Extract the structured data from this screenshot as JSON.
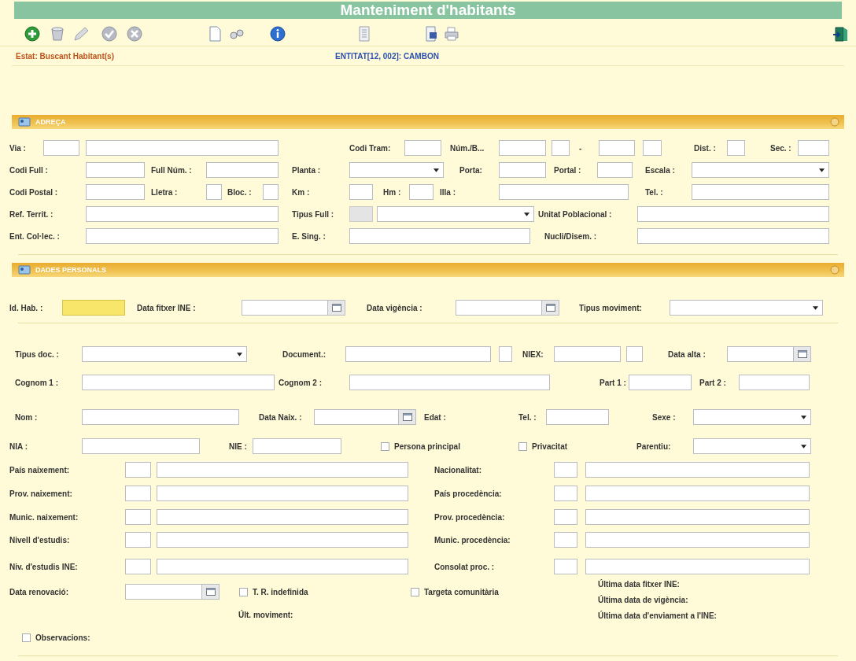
{
  "title": "Manteniment d'habitants",
  "toolbar": [
    {
      "kind": "add"
    },
    {
      "kind": "delete"
    },
    {
      "kind": "edit"
    },
    {
      "kind": "accept"
    },
    {
      "kind": "cancel"
    },
    {
      "kind": "new"
    },
    {
      "kind": "view"
    },
    {
      "kind": "info"
    },
    {
      "kind": "list"
    },
    {
      "kind": "export"
    },
    {
      "kind": "print"
    },
    {
      "kind": "exit"
    }
  ],
  "status": "Estat: Buscant Habitant(s)",
  "entity": "ENTITAT[12, 002]: CAMBON",
  "sections": [
    {
      "title": "ADREÇA",
      "rows": [
        {
          "fields": [
            {
              "kind": "label",
              "text": "Via :"
            },
            {
              "kind": "input"
            },
            {
              "kind": "input"
            },
            {
              "kind": "label",
              "text": "Codi Tram:"
            },
            {
              "kind": "input"
            },
            {
              "kind": "label",
              "text": "Núm./B..."
            },
            {
              "kind": "input"
            },
            {
              "kind": "input"
            },
            {
              "kind": "label",
              "text": "-"
            },
            {
              "kind": "input"
            },
            {
              "kind": "input"
            },
            {
              "kind": "label",
              "text": "Dist. :"
            },
            {
              "kind": "input"
            },
            {
              "kind": "label",
              "text": "Sec. :"
            },
            {
              "kind": "input"
            }
          ]
        },
        {
          "fields": [
            {
              "kind": "label",
              "text": "Codi Full :"
            },
            {
              "kind": "input"
            },
            {
              "kind": "label",
              "text": "Full Núm. :"
            },
            {
              "kind": "input"
            },
            {
              "kind": "label",
              "text": "Planta :"
            },
            {
              "kind": "select"
            },
            {
              "kind": "label",
              "text": "Porta:"
            },
            {
              "kind": "input"
            },
            {
              "kind": "label",
              "text": "Portal :"
            },
            {
              "kind": "input"
            },
            {
              "kind": "label",
              "text": "Escala :"
            },
            {
              "kind": "select"
            }
          ]
        },
        {
          "fields": [
            {
              "kind": "label",
              "text": "Codi Postal :"
            },
            {
              "kind": "input"
            },
            {
              "kind": "label",
              "text": "Lletra :"
            },
            {
              "kind": "input"
            },
            {
              "kind": "label",
              "text": "Bloc. :"
            },
            {
              "kind": "input"
            },
            {
              "kind": "label",
              "text": "Km :"
            },
            {
              "kind": "input"
            },
            {
              "kind": "label",
              "text": "Hm :"
            },
            {
              "kind": "input"
            },
            {
              "kind": "label",
              "text": "Illa :"
            },
            {
              "kind": "input"
            },
            {
              "kind": "label",
              "text": "Tel. :"
            },
            {
              "kind": "input"
            }
          ]
        },
        {
          "fields": [
            {
              "kind": "label",
              "text": "Ref. Territ. :"
            },
            {
              "kind": "input"
            },
            {
              "kind": "label",
              "text": "Tipus Full :"
            },
            {
              "kind": "input",
              "disabled": true
            },
            {
              "kind": "select"
            },
            {
              "kind": "label",
              "text": "Unitat Poblacional :"
            },
            {
              "kind": "input"
            }
          ]
        },
        {
          "fields": [
            {
              "kind": "label",
              "text": "Ent. Col·lec. :"
            },
            {
              "kind": "input"
            },
            {
              "kind": "label",
              "text": "E. Sing. :"
            },
            {
              "kind": "input"
            },
            {
              "kind": "label",
              "text": "Nucli/Disem. :"
            },
            {
              "kind": "input"
            }
          ]
        }
      ]
    },
    {
      "title": "DADES PERSONALS",
      "rows": [
        {
          "fields": [
            {
              "kind": "label",
              "text": "Id. Hab. :"
            },
            {
              "kind": "input",
              "highlighted": true
            },
            {
              "kind": "label",
              "text": "Data fitxer INE :"
            },
            {
              "kind": "date"
            },
            {
              "kind": "label",
              "text": "Data vigència :"
            },
            {
              "kind": "date"
            },
            {
              "kind": "label",
              "text": "Tipus moviment:"
            },
            {
              "kind": "select"
            }
          ]
        },
        {
          "fields": [
            {
              "kind": "label",
              "text": "Tipus doc. :"
            },
            {
              "kind": "select"
            },
            {
              "kind": "label",
              "text": "Document.:"
            },
            {
              "kind": "input"
            },
            {
              "kind": "input"
            },
            {
              "kind": "label",
              "text": "NIEX:"
            },
            {
              "kind": "input"
            },
            {
              "kind": "input"
            },
            {
              "kind": "label",
              "text": "Data alta :"
            },
            {
              "kind": "date"
            }
          ]
        },
        {
          "fields": [
            {
              "kind": "label",
              "text": "Cognom 1 :"
            },
            {
              "kind": "input"
            },
            {
              "kind": "label",
              "text": "Cognom 2 :"
            },
            {
              "kind": "input"
            },
            {
              "kind": "label",
              "text": "Part 1 :"
            },
            {
              "kind": "input"
            },
            {
              "kind": "label",
              "text": "Part 2 :"
            },
            {
              "kind": "input"
            }
          ]
        },
        {
          "fields": [
            {
              "kind": "label",
              "text": "Nom :"
            },
            {
              "kind": "input"
            },
            {
              "kind": "label",
              "text": "Data Naix. :"
            },
            {
              "kind": "date"
            },
            {
              "kind": "label",
              "text": "Edat :"
            },
            {
              "kind": "label",
              "text": "Tel. :"
            },
            {
              "kind": "input"
            },
            {
              "kind": "label",
              "text": "Sexe :"
            },
            {
              "kind": "select"
            }
          ]
        },
        {
          "fields": [
            {
              "kind": "label",
              "text": "NIA :"
            },
            {
              "kind": "input"
            },
            {
              "kind": "label",
              "text": "NIE :"
            },
            {
              "kind": "input"
            },
            {
              "kind": "check",
              "text": "Persona principal",
              "checked": false
            },
            {
              "kind": "check",
              "text": "Privacitat",
              "checked": false
            },
            {
              "kind": "label",
              "text": "Parentiu:"
            },
            {
              "kind": "select"
            }
          ]
        },
        {
          "fields": [
            {
              "kind": "label",
              "text": "País naixement:"
            },
            {
              "kind": "input"
            },
            {
              "kind": "input"
            },
            {
              "kind": "label",
              "text": "Nacionalitat:"
            },
            {
              "kind": "input"
            },
            {
              "kind": "input"
            }
          ]
        },
        {
          "fields": [
            {
              "kind": "label",
              "text": "Prov. naixement:"
            },
            {
              "kind": "input"
            },
            {
              "kind": "input"
            },
            {
              "kind": "label",
              "text": "País procedència:"
            },
            {
              "kind": "input"
            },
            {
              "kind": "input"
            }
          ]
        },
        {
          "fields": [
            {
              "kind": "label",
              "text": "Munic. naixement:"
            },
            {
              "kind": "input"
            },
            {
              "kind": "input"
            },
            {
              "kind": "label",
              "text": "Prov. procedència:"
            },
            {
              "kind": "input"
            },
            {
              "kind": "input"
            }
          ]
        },
        {
          "fields": [
            {
              "kind": "label",
              "text": "Nivell d'estudis:"
            },
            {
              "kind": "input"
            },
            {
              "kind": "input"
            },
            {
              "kind": "label",
              "text": "Munic. procedència:"
            },
            {
              "kind": "input"
            },
            {
              "kind": "input"
            }
          ]
        },
        {
          "fields": [
            {
              "kind": "label",
              "text": "Niv. d'estudis INE:"
            },
            {
              "kind": "input"
            },
            {
              "kind": "input"
            },
            {
              "kind": "label",
              "text": "Consolat proc. :"
            },
            {
              "kind": "input"
            },
            {
              "kind": "input"
            }
          ]
        }
      ],
      "footer": {
        "items": [
          {
            "kind": "label",
            "text": "Data renovació:"
          },
          {
            "kind": "date"
          },
          {
            "kind": "check",
            "text": "T. R. indefinida",
            "checked": false
          },
          {
            "kind": "check",
            "text": "Targeta comunitària",
            "checked": false
          }
        ],
        "last_movement": "Últ. moviment:",
        "last_dates": [
          "Última data fitxer INE:",
          "Última data de vigència:",
          "Última data d'enviament a l'INE:"
        ],
        "observations": {
          "text": "Observacions:",
          "checked": false
        }
      }
    }
  ]
}
